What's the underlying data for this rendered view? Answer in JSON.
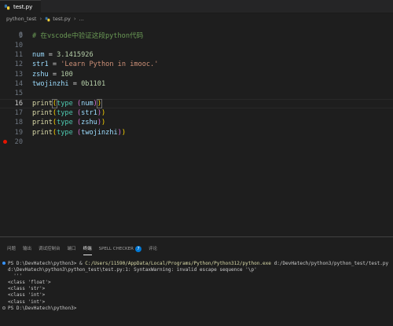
{
  "tabs": [
    {
      "label": "test.py",
      "icon": "python-file-icon"
    }
  ],
  "breadcrumb": {
    "folder": "python_test",
    "file": "test.py",
    "symbol": "..."
  },
  "editor": {
    "partial_line_number": "8",
    "active_line": 16,
    "breakpoint_line": 20,
    "lines": [
      {
        "n": "9",
        "tokens": [
          {
            "t": "# 在vscode中验证这段python代码",
            "c": "comment"
          }
        ]
      },
      {
        "n": "10",
        "tokens": []
      },
      {
        "n": "11",
        "tokens": [
          {
            "t": "num",
            "c": "var"
          },
          {
            "t": " = ",
            "c": "op"
          },
          {
            "t": "3.1415926",
            "c": "num"
          }
        ]
      },
      {
        "n": "12",
        "tokens": [
          {
            "t": "str1",
            "c": "var"
          },
          {
            "t": " = ",
            "c": "op"
          },
          {
            "t": "'Learn Python in imooc.'",
            "c": "str"
          }
        ]
      },
      {
        "n": "13",
        "tokens": [
          {
            "t": "zshu",
            "c": "var"
          },
          {
            "t": " = ",
            "c": "op"
          },
          {
            "t": "100",
            "c": "num"
          }
        ]
      },
      {
        "n": "14",
        "tokens": [
          {
            "t": "twojinzhi",
            "c": "var"
          },
          {
            "t": " = ",
            "c": "op"
          },
          {
            "t": "0b1101",
            "c": "num"
          }
        ]
      },
      {
        "n": "15",
        "tokens": []
      },
      {
        "n": "16",
        "tokens": [
          {
            "t": "print",
            "c": "fn"
          },
          {
            "t": "(",
            "c": "b1"
          },
          {
            "t": "type",
            "c": "type"
          },
          {
            "t": " ",
            "c": "op"
          },
          {
            "t": "(",
            "c": "b2"
          },
          {
            "t": "num",
            "c": "var"
          },
          {
            "t": ")",
            "c": "b2"
          },
          {
            "t": ")",
            "c": "b1"
          }
        ]
      },
      {
        "n": "17",
        "tokens": [
          {
            "t": "print",
            "c": "fn"
          },
          {
            "t": "(",
            "c": "b1"
          },
          {
            "t": "type",
            "c": "type"
          },
          {
            "t": " ",
            "c": "op"
          },
          {
            "t": "(",
            "c": "b2"
          },
          {
            "t": "str1",
            "c": "var"
          },
          {
            "t": ")",
            "c": "b2"
          },
          {
            "t": ")",
            "c": "b1"
          }
        ]
      },
      {
        "n": "18",
        "tokens": [
          {
            "t": "print",
            "c": "fn"
          },
          {
            "t": "(",
            "c": "b1"
          },
          {
            "t": "type",
            "c": "type"
          },
          {
            "t": " ",
            "c": "op"
          },
          {
            "t": "(",
            "c": "b2"
          },
          {
            "t": "zshu",
            "c": "var"
          },
          {
            "t": ")",
            "c": "b2"
          },
          {
            "t": ")",
            "c": "b1"
          }
        ]
      },
      {
        "n": "19",
        "tokens": [
          {
            "t": "print",
            "c": "fn"
          },
          {
            "t": "(",
            "c": "b1"
          },
          {
            "t": "type",
            "c": "type"
          },
          {
            "t": " ",
            "c": "op"
          },
          {
            "t": "(",
            "c": "b2"
          },
          {
            "t": "twojinzhi",
            "c": "var"
          },
          {
            "t": ")",
            "c": "b2"
          },
          {
            "t": ")",
            "c": "b1"
          }
        ]
      },
      {
        "n": "20",
        "tokens": []
      }
    ]
  },
  "panel": {
    "tabs": [
      {
        "label": "问题",
        "active": false
      },
      {
        "label": "输出",
        "active": false
      },
      {
        "label": "调试控制台",
        "active": false
      },
      {
        "label": "端口",
        "active": false
      },
      {
        "label": "终端",
        "active": true
      },
      {
        "label": "SPELL CHECKER",
        "active": false,
        "badge": "7"
      },
      {
        "label": "评论",
        "active": false
      }
    ]
  },
  "terminal": {
    "lines": [
      {
        "dot": "blue",
        "parts": [
          {
            "t": "PS D:\\DevHatech\\python3> & ",
            "c": ""
          },
          {
            "t": "C:/Users/11590/AppData/Local/Programs/Python/Python312/python.exe",
            "c": "yellow"
          },
          {
            "t": " d:/DevHatech/python3/python_test/test.py",
            "c": ""
          }
        ]
      },
      {
        "dot": "",
        "parts": [
          {
            "t": "d:\\DevHatech\\python3\\python_test\\test.py:1: SyntaxWarning: invalid escape sequence '\\p'",
            "c": ""
          }
        ]
      },
      {
        "dot": "",
        "parts": [
          {
            "t": "  '''",
            "c": ""
          }
        ]
      },
      {
        "dot": "",
        "parts": [
          {
            "t": "<class 'float'>",
            "c": ""
          }
        ]
      },
      {
        "dot": "",
        "parts": [
          {
            "t": "<class 'str'>",
            "c": ""
          }
        ]
      },
      {
        "dot": "",
        "parts": [
          {
            "t": "<class 'int'>",
            "c": ""
          }
        ]
      },
      {
        "dot": "",
        "parts": [
          {
            "t": "<class 'int'>",
            "c": ""
          }
        ]
      },
      {
        "dot": "ring",
        "parts": [
          {
            "t": "PS D:\\DevHatech\\python3> ",
            "c": ""
          }
        ]
      }
    ]
  },
  "colors": {
    "background": "#1e1e1e",
    "breakpoint": "#e51400",
    "accent": "#0078d4"
  }
}
